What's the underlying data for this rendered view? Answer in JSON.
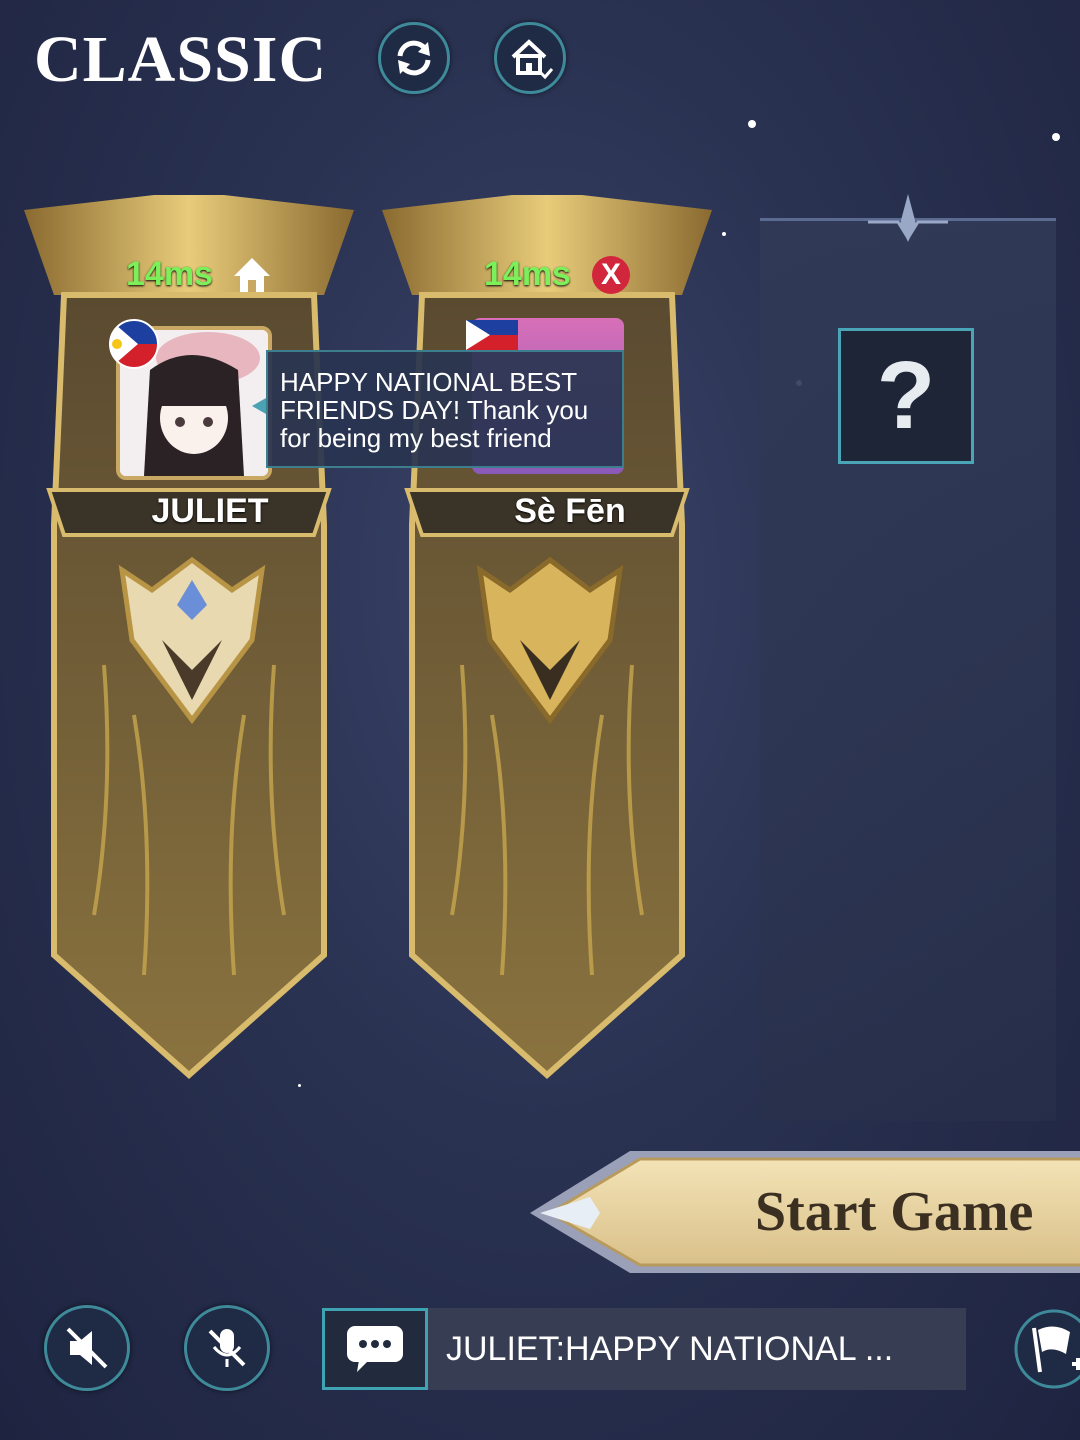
{
  "header": {
    "mode_title": "CLASSIC",
    "refresh_icon": "refresh-icon",
    "home_icon": "home-icon"
  },
  "players": [
    {
      "name": "JULIET",
      "ping": "14ms",
      "status_icon": "home-icon",
      "flag": "philippines-flag",
      "message": [
        "HAPPY NATIONAL BEST",
        "FRIENDS DAY! Thank you",
        "for being my best friend"
      ]
    },
    {
      "name": "Sè Fēn",
      "ping": "14ms",
      "status_icon": "close-icon",
      "status_glyph": "X",
      "flag": "philippines-flag"
    }
  ],
  "empty_slot": {
    "label": "?"
  },
  "start_button": {
    "label": "Start Game"
  },
  "chat": {
    "preview": "JULIET:HAPPY NATIONAL ...",
    "icon": "chat-bubble-icon"
  },
  "controls": {
    "speaker_muted_icon": "speaker-muted-icon",
    "mic_muted_icon": "mic-muted-icon",
    "flag_add_icon": "flag-add-icon"
  },
  "colors": {
    "ping_green": "#7cf05a",
    "gold": "#c9a863",
    "teal_border": "#3fa3b4",
    "status_red": "#d2263c"
  }
}
